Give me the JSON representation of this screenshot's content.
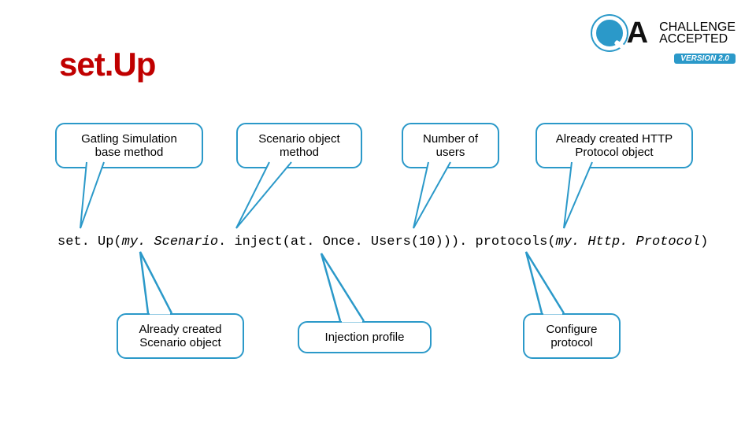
{
  "title": "set.Up",
  "logo": {
    "challenge": "CHALLENGE",
    "accepted": "ACCEPTED",
    "version": "VERSION 2.0"
  },
  "bubbles": {
    "b1": "Gatling Simulation base method",
    "b2": "Scenario object method",
    "b3": "Number of users",
    "b4": "Already created HTTP Protocol object",
    "b5": "Already created Scenario object",
    "b6": "Injection profile",
    "b7": "Configure protocol"
  },
  "code": {
    "p1": "set. Up(",
    "p2": "my. Scenario",
    "p3": ". inject(at. Once. Users(10))). protocols(",
    "p4": "my. Http. Protocol",
    "p5": ")"
  }
}
